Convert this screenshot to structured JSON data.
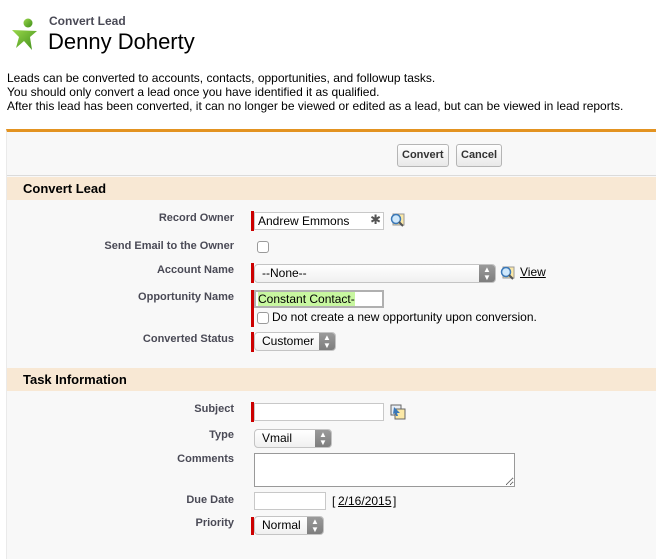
{
  "header": {
    "subtitle": "Convert Lead",
    "title": "Denny Doherty",
    "icon": "leads-person-icon"
  },
  "intro": {
    "lines": [
      "Leads can be converted to accounts, contacts, opportunities, and followup tasks.",
      "You should only convert a lead once you have identified it as qualified.",
      "After this lead has been converted, it can no longer be viewed or edited as a lead, but can be viewed in lead reports."
    ]
  },
  "buttons": {
    "convert": "Convert",
    "cancel": "Cancel"
  },
  "convert_section": {
    "title": "Convert Lead",
    "record_owner": {
      "label": "Record Owner",
      "value": "Andrew Emmons",
      "required": true
    },
    "send_email": {
      "label": "Send Email to the Owner",
      "checked": false
    },
    "account_name": {
      "label": "Account Name",
      "value": "--None--",
      "view_link": "View",
      "required": true
    },
    "opportunity_name": {
      "label": "Opportunity Name",
      "value": "Constant Contact-",
      "required": true
    },
    "no_opportunity": {
      "label": "Do not create a new opportunity upon conversion.",
      "checked": false
    },
    "converted_status": {
      "label": "Converted Status",
      "value": "Customer",
      "required": true
    }
  },
  "task_section": {
    "title": "Task Information",
    "subject": {
      "label": "Subject",
      "value": "",
      "required": true
    },
    "type": {
      "label": "Type",
      "value": "Vmail"
    },
    "comments": {
      "label": "Comments",
      "value": ""
    },
    "due_date": {
      "label": "Due Date",
      "value": "",
      "bracket_open": "[",
      "today_link": "2/16/2015",
      "bracket_close": "]"
    },
    "priority": {
      "label": "Priority",
      "value": "Normal",
      "required": true
    }
  },
  "colors": {
    "accent": "#e39321",
    "section_bg": "#f8e8d4",
    "required": "#cc0000",
    "highlight": "#c8f7a0"
  }
}
